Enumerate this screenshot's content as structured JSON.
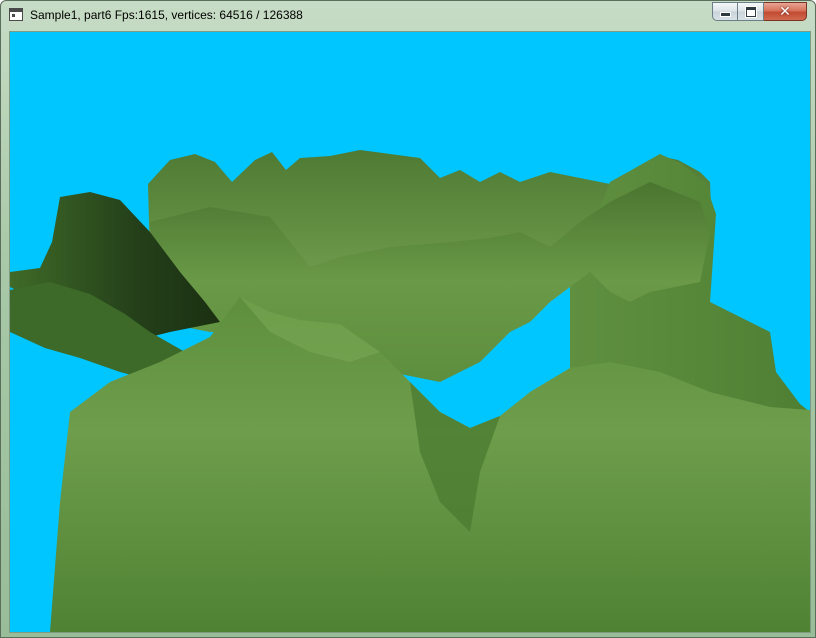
{
  "window": {
    "title": "Sample1, part6  Fps:1615, vertices: 64516 / 126388",
    "icon": "app-window-icon",
    "controls": {
      "minimize_icon": "minimize-icon",
      "maximize_icon": "maximize-icon",
      "close_icon": "close-icon",
      "close_glyph": "✕"
    }
  },
  "scene": {
    "description_type": "3d-terrain-render",
    "sky_color": "#00c6ff",
    "terrain_color_light": "#6f9e4c",
    "terrain_color_mid": "#5b8a3c",
    "terrain_color_dark": "#2e4d1c"
  }
}
